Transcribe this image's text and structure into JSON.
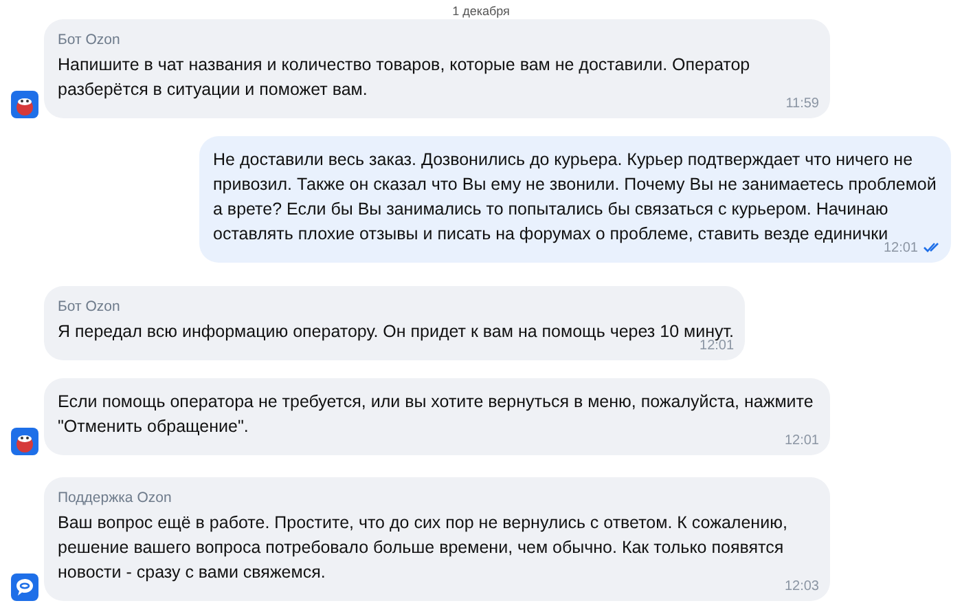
{
  "date_divider": "1 декабря",
  "messages": [
    {
      "kind": "incoming",
      "sender": "Бот Ozon",
      "text": "Напишите в чат названия и количество товаров, которые вам не доставили. Оператор разберётся в ситуации и поможет вам.",
      "time": "11:59",
      "avatar": {
        "kind": "bot"
      }
    },
    {
      "kind": "outgoing",
      "text": "Не доставили весь заказ. Дозвонились до курьера. Курьер подтверждает что ничего не привозил. Также он сказал что Вы ему не звонили. Почему Вы не занимаетесь проблемой а врете? Если бы Вы занимались то попытались бы связаться с курьером. Начинаю оставлять плохие отзывы и писать на форумах о проблеме, ставить везде единички",
      "time": "12:01",
      "read": true
    },
    {
      "kind": "incoming",
      "sender": "Бот Ozon",
      "text": "Я передал всю информацию оператору. Он придет к вам на помощь через 10 минут.",
      "time": "12:01"
    },
    {
      "kind": "incoming",
      "text": "Если помощь оператора не требуется, или вы хотите вернуться в меню, пожалуйста, нажмите \"Отменить обращение\".",
      "time": "12:01",
      "avatar": {
        "kind": "bot"
      }
    },
    {
      "kind": "incoming",
      "sender": "Поддержка Ozon",
      "text": "Ваш вопрос ещё в работе. Простите, что до сих пор не вернулись с ответом. К сожалению, решение вашего вопроса потребовало больше времени, чем обычно. Как только появятся новости - сразу с вами свяжемся.",
      "time": "12:03",
      "avatar": {
        "kind": "support"
      }
    }
  ]
}
